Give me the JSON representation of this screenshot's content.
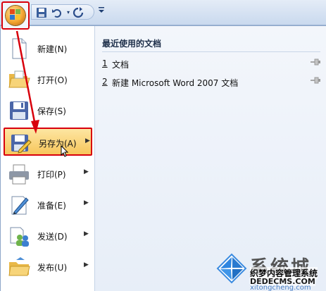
{
  "quick_access": {
    "save_icon": "floppy-disk-icon",
    "undo_icon": "undo-icon",
    "redo_icon": "redo-icon",
    "customize_icon": "dropdown-arrow-icon"
  },
  "menu": {
    "items": [
      {
        "label": "新建(N)",
        "icon": "new-document-icon",
        "has_submenu": false
      },
      {
        "label": "打开(O)",
        "icon": "open-folder-icon",
        "has_submenu": false
      },
      {
        "label": "保存(S)",
        "icon": "floppy-disk-icon",
        "has_submenu": false
      },
      {
        "label": "另存为(A)",
        "icon": "save-as-icon",
        "has_submenu": true,
        "selected": true
      },
      {
        "label": "打印(P)",
        "icon": "printer-icon",
        "has_submenu": true
      },
      {
        "label": "准备(E)",
        "icon": "prepare-pen-icon",
        "has_submenu": true
      },
      {
        "label": "发送(D)",
        "icon": "send-people-icon",
        "has_submenu": true
      },
      {
        "label": "发布(U)",
        "icon": "publish-folder-icon",
        "has_submenu": true
      }
    ]
  },
  "recent": {
    "title": "最近使用的文档",
    "items": [
      {
        "num": "1",
        "name": "文档"
      },
      {
        "num": "2",
        "name": "新建 Microsoft Word 2007 文档"
      }
    ]
  },
  "watermark": {
    "brand": "系统城",
    "site_name": "织梦内容管理系统",
    "site_url": "DEDECMS.COM",
    "domain": "xitongcheng.com"
  },
  "colors": {
    "highlight_border": "#d8000c",
    "selected_bg": "#f7c65c"
  }
}
